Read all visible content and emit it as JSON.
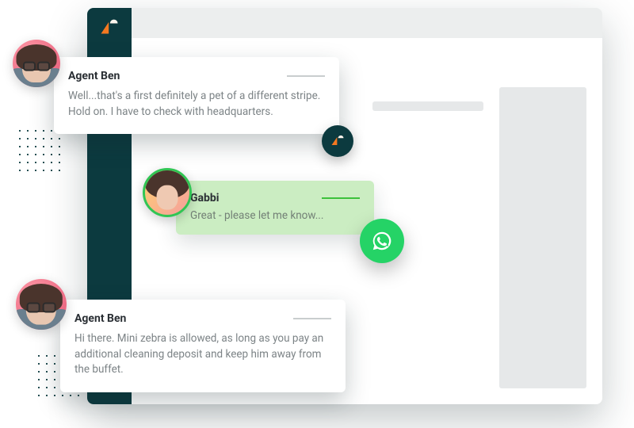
{
  "messages": {
    "agent1": {
      "name": "Agent Ben",
      "body": "Well...that's a first definitely a pet of a different stripe. Hold on. I have to check with headquarters."
    },
    "customer": {
      "name": "Gabbi",
      "body": "Great - please let me know..."
    },
    "agent2": {
      "name": "Agent Ben",
      "body": "Hi there. Mini zebra is allowed, as long as you pay an additional cleaning deposit and keep him away from the buffet."
    }
  },
  "icons": {
    "brand": "zendesk-logo",
    "whatsapp": "whatsapp-icon"
  },
  "colors": {
    "sidebar": "#0c3a3f",
    "customer_bubble": "#cbedc2",
    "whatsapp": "#25d366",
    "accent_green": "#3cc13b"
  }
}
